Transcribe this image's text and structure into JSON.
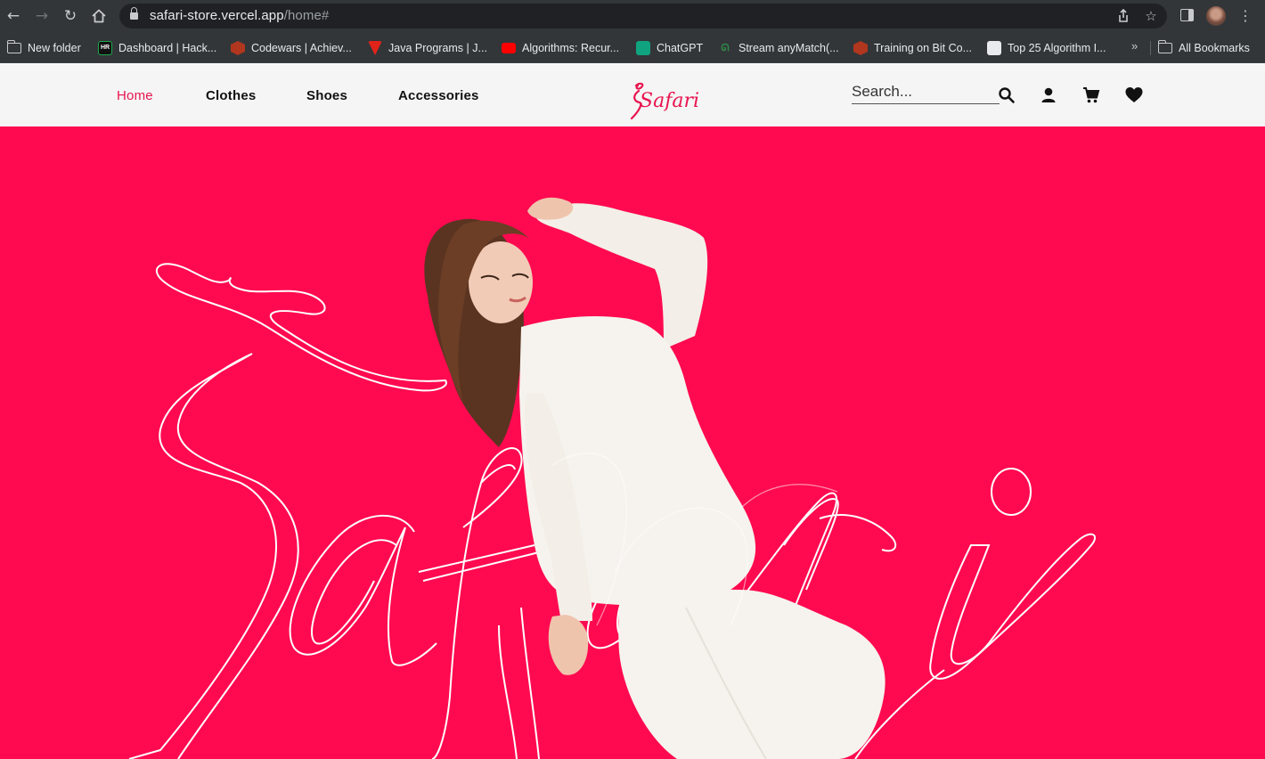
{
  "browser": {
    "url_host": "safari-store.vercel.app",
    "url_path": "/home#",
    "bookmarks": [
      {
        "label": "New folder",
        "icon": "folder-icon"
      },
      {
        "label": "Dashboard | Hack...",
        "icon": "hackerrank-icon"
      },
      {
        "label": "Codewars | Achiev...",
        "icon": "codewars-icon"
      },
      {
        "label": "Java Programs | J...",
        "icon": "java-icon"
      },
      {
        "label": "Algorithms: Recur...",
        "icon": "youtube-icon"
      },
      {
        "label": "ChatGPT",
        "icon": "chatgpt-icon"
      },
      {
        "label": "Stream anyMatch(...",
        "icon": "geeksforgeeks-icon"
      },
      {
        "label": "Training on Bit Co...",
        "icon": "codewars-icon"
      },
      {
        "label": "Top 25 Algorithm I...",
        "icon": "globe-icon"
      }
    ],
    "bookmarks_overflow": "»",
    "all_bookmarks": "All Bookmarks",
    "hackerrank_glyph": "HR"
  },
  "site": {
    "nav": [
      {
        "label": "Home",
        "active": true
      },
      {
        "label": "Clothes",
        "active": false
      },
      {
        "label": "Shoes",
        "active": false
      },
      {
        "label": "Accessories",
        "active": false
      }
    ],
    "logo_text": "Safari",
    "search_placeholder": "Search...",
    "icons": [
      "search-icon",
      "user-icon",
      "cart-icon",
      "heart-icon"
    ]
  },
  "hero": {
    "script_text": "Safari",
    "background": "#ff0a50"
  },
  "colors": {
    "accent": "#e8154f",
    "chrome": "#323639",
    "header_bg": "#f5f5f5"
  }
}
